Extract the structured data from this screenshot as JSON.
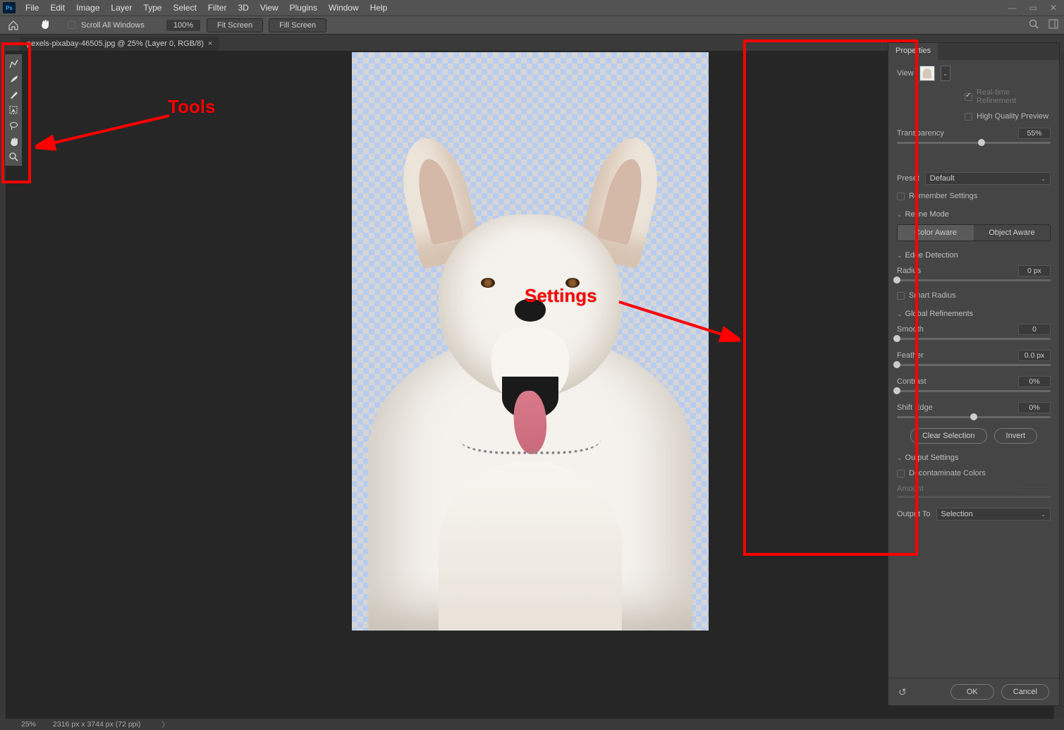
{
  "menubar": {
    "logo": "Ps",
    "items": [
      "File",
      "Edit",
      "Image",
      "Layer",
      "Type",
      "Select",
      "Filter",
      "3D",
      "View",
      "Plugins",
      "Window",
      "Help"
    ]
  },
  "optionsbar": {
    "scroll_all": "Scroll All Windows",
    "zoom_pct": "100%",
    "fit_screen": "Fit Screen",
    "fill_screen": "Fill Screen"
  },
  "document_tab": {
    "title": "pexels-pixabay-46505.jpg @ 25% (Layer 0, RGB/8)"
  },
  "annotations": {
    "tools": "Tools",
    "settings": "Settings"
  },
  "panel": {
    "title": "Properties",
    "view": {
      "label": "View",
      "realtime": "Real-time Refinement",
      "hq": "High Quality Preview"
    },
    "transparency": {
      "label": "Transparency",
      "value": "55%"
    },
    "preset": {
      "label": "Preset",
      "value": "Default"
    },
    "remember": "Remember Settings",
    "refine_mode": {
      "title": "Refine Mode",
      "color_aware": "Color Aware",
      "object_aware": "Object Aware"
    },
    "edge_detection": {
      "title": "Edge Detection",
      "radius": "Radius",
      "radius_val": "0 px",
      "smart_radius": "Smart Radius"
    },
    "global": {
      "title": "Global Refinements",
      "smooth": "Smooth",
      "smooth_val": "0",
      "feather": "Feather",
      "feather_val": "0.0 px",
      "contrast": "Contrast",
      "contrast_val": "0%",
      "shift": "Shift Edge",
      "shift_val": "0%"
    },
    "clear_sel": "Clear Selection",
    "invert": "Invert",
    "output": {
      "title": "Output Settings",
      "decon": "Decontaminate Colors",
      "amount": "Amount",
      "output_to": "Output To",
      "output_to_val": "Selection"
    }
  },
  "footer": {
    "ok": "OK",
    "cancel": "Cancel"
  },
  "statusbar": {
    "zoom": "25%",
    "dimensions": "2316 px x 3744 px (72 ppi)"
  }
}
